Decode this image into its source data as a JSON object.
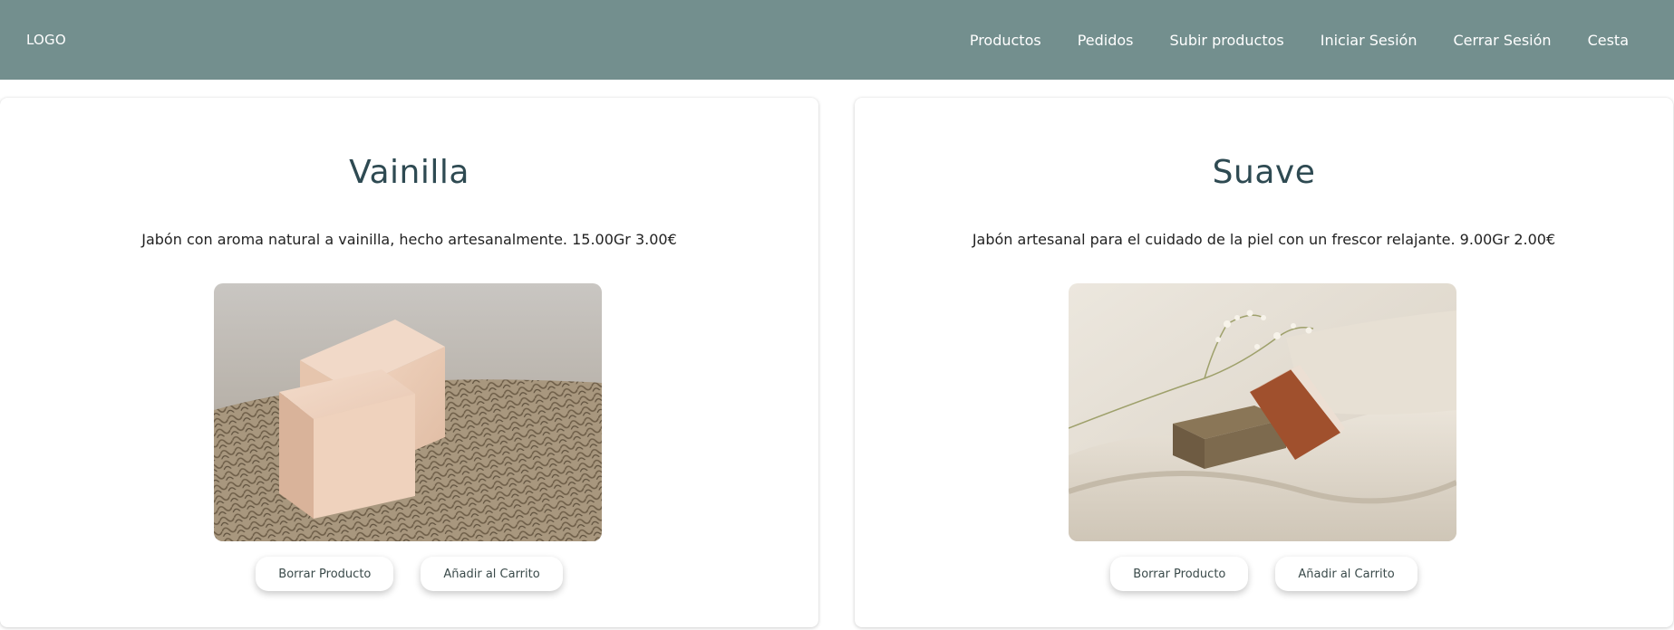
{
  "navbar": {
    "logo": "LOGO",
    "links": [
      "Productos",
      "Pedidos",
      "Subir productos",
      "Iniciar Sesión",
      "Cerrar Sesión",
      "Cesta"
    ]
  },
  "products": [
    {
      "title": "Vainilla",
      "description": "Jabón con aroma natural a vainilla, hecho artesanalmente. 15.00Gr 3.00€",
      "image_icon": "soap-vanilla-image",
      "delete_label": "Borrar Producto",
      "cart_label": "Añadir al Carrito"
    },
    {
      "title": "Suave",
      "description": "Jabón artesanal para el cuidado de la piel con un frescor relajante. 9.00Gr 2.00€",
      "image_icon": "soap-suave-image",
      "delete_label": "Borrar Producto",
      "cart_label": "Añadir al Carrito"
    }
  ],
  "colors": {
    "navbar": "#738f8e",
    "title": "#2e4a52"
  }
}
